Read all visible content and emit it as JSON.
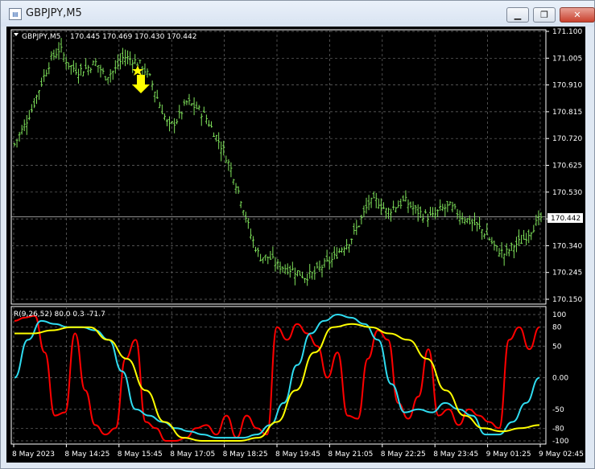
{
  "window": {
    "title": "GBPJPY,M5",
    "minimize_icon": "minimize-icon",
    "maximize_icon": "maximize-icon",
    "close_icon": "close-icon",
    "app_icon": "chart-window-icon"
  },
  "chart_header": {
    "symbol": "GBPJPY,M5",
    "ohlc": "170.445 170.469 170.430 170.442",
    "current_price": "170.442"
  },
  "chart_data": [
    {
      "type": "bar",
      "series_name": "GBPJPY,M5",
      "ylim": [
        170.15,
        171.1
      ],
      "y_ticks": [
        "171.100",
        "171.005",
        "170.910",
        "170.815",
        "170.720",
        "170.625",
        "170.530",
        "170.435",
        "170.340",
        "170.245",
        "170.150"
      ],
      "x_ticks": [
        "8 May 2023",
        "8 May 14:25",
        "8 May 15:45",
        "8 May 17:05",
        "8 May 18:25",
        "8 May 19:45",
        "8 May 21:05",
        "8 May 22:25",
        "8 May 23:45",
        "9 May 01:25",
        "9 May 02:45"
      ],
      "close_path": [
        170.7,
        170.76,
        170.83,
        170.92,
        171.0,
        171.04,
        170.98,
        170.96,
        170.97,
        170.99,
        170.94,
        170.96,
        171.01,
        171.0,
        170.98,
        170.93,
        170.84,
        170.76,
        170.79,
        170.85,
        170.83,
        170.8,
        170.74,
        170.68,
        170.6,
        170.5,
        170.38,
        170.3,
        170.3,
        170.27,
        170.26,
        170.25,
        170.23,
        170.24,
        170.27,
        170.29,
        170.33,
        170.36,
        170.42,
        170.49,
        170.5,
        170.46,
        170.48,
        170.5,
        170.47,
        170.45,
        170.44,
        170.47,
        170.48,
        170.45,
        170.43,
        170.41,
        170.38,
        170.33,
        170.31,
        170.34,
        170.36,
        170.4,
        170.44
      ],
      "grid": true,
      "annotation": "sell-arrow"
    },
    {
      "type": "line",
      "title": "R(9,26,52) 80.0 0.3 -71.7",
      "ylim": [
        -100,
        100
      ],
      "y_ticks": [
        "100",
        "80",
        "50",
        "0.00",
        "-50",
        "-80",
        "-100"
      ],
      "levels": [
        80,
        -80
      ],
      "series": [
        {
          "name": "R(9,26,52)",
          "color": "#ff0000",
          "values": [
            90,
            95,
            98,
            40,
            -60,
            -55,
            70,
            -20,
            -75,
            -90,
            -80,
            30,
            60,
            -70,
            -80,
            -100,
            -100,
            -95,
            -80,
            -75,
            -90,
            -60,
            -95,
            -60,
            -80,
            -90,
            80,
            60,
            85,
            70,
            50,
            0,
            40,
            -60,
            -65,
            30,
            75,
            60,
            -40,
            -65,
            -30,
            45,
            -60,
            -50,
            -75,
            -50,
            -60,
            -70,
            -80,
            60,
            80,
            45,
            80
          ]
        },
        {
          "name": "0.3",
          "color": "#2fdcf0",
          "values": [
            0,
            60,
            90,
            85,
            80,
            80,
            75,
            60,
            10,
            -50,
            -60,
            -70,
            -80,
            -85,
            -90,
            -95,
            -95,
            -95,
            -90,
            -75,
            -40,
            20,
            70,
            90,
            100,
            95,
            85,
            60,
            -10,
            -55,
            -50,
            -55,
            -40,
            -50,
            -60,
            -90,
            -90,
            -70,
            -40,
            0
          ]
        },
        {
          "name": "-71.7",
          "color": "#ffff00",
          "values": [
            70,
            70,
            75,
            80,
            80,
            60,
            30,
            -20,
            -70,
            -95,
            -100,
            -100,
            -100,
            -95,
            -70,
            -20,
            40,
            80,
            85,
            80,
            70,
            60,
            30,
            -20,
            -60,
            -80,
            -85,
            -80,
            -75
          ]
        }
      ],
      "grid": true
    }
  ]
}
